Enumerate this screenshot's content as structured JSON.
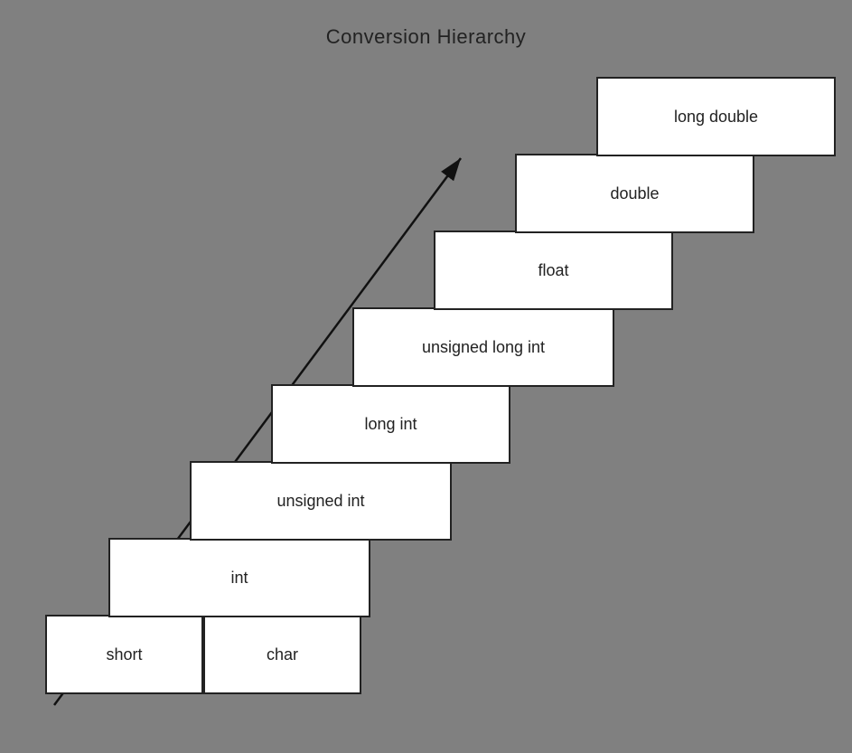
{
  "title": "Conversion Hierarchy",
  "steps": [
    {
      "id": "short",
      "label": "short"
    },
    {
      "id": "char",
      "label": "char"
    },
    {
      "id": "int",
      "label": "int"
    },
    {
      "id": "unsigned-int",
      "label": "unsigned int"
    },
    {
      "id": "long-int",
      "label": "long int"
    },
    {
      "id": "unsigned-long-int",
      "label": "unsigned long int"
    },
    {
      "id": "float",
      "label": "float"
    },
    {
      "id": "double",
      "label": "double"
    },
    {
      "id": "long-double",
      "label": "long double"
    }
  ],
  "arrow": {
    "description": "diagonal arrow from bottom-left to top-right"
  }
}
